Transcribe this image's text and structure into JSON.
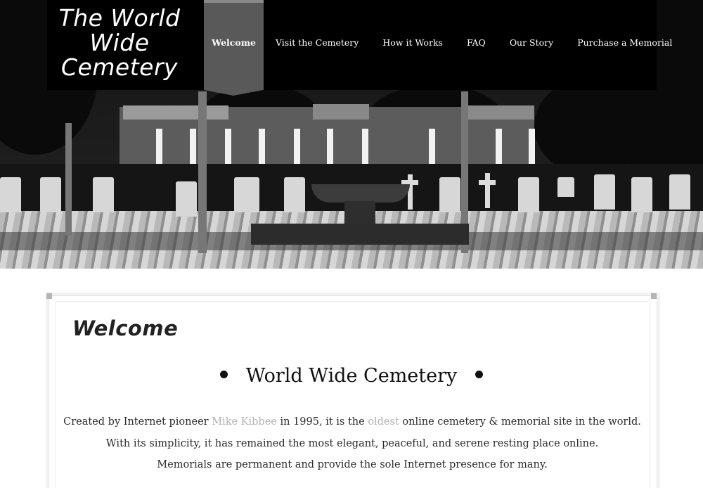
{
  "site": {
    "logo_line1": "The World",
    "logo_line2": "Wide",
    "logo_line3": "Cemetery"
  },
  "nav": {
    "items": [
      {
        "label": "Welcome",
        "active": true
      },
      {
        "label": "Visit the Cemetery"
      },
      {
        "label": "How it Works"
      },
      {
        "label": "FAQ"
      },
      {
        "label": "Our Story"
      },
      {
        "label": "Purchase a Memorial"
      }
    ]
  },
  "hero": {
    "image_icon": "cemetery-photo"
  },
  "content": {
    "heading": "Welcome",
    "subtitle": "World Wide Cemetery",
    "para1_before": "Created by Internet pioneer ",
    "para1_link1": "Mike Kibbee",
    "para1_middle": " in 1995, it is the ",
    "para1_link2": "oldest",
    "para1_after": " online cemetery & memorial site in the world.",
    "para2": "With its simplicity, it has remained the most elegant, peaceful, and serene resting place online.",
    "para3": "Memorials are permanent and provide the sole Internet presence for many."
  },
  "colors": {
    "header_bg": "#000000",
    "active_tab": "#595959",
    "link": "#b3b3b3",
    "text": "#2b2b2b"
  }
}
